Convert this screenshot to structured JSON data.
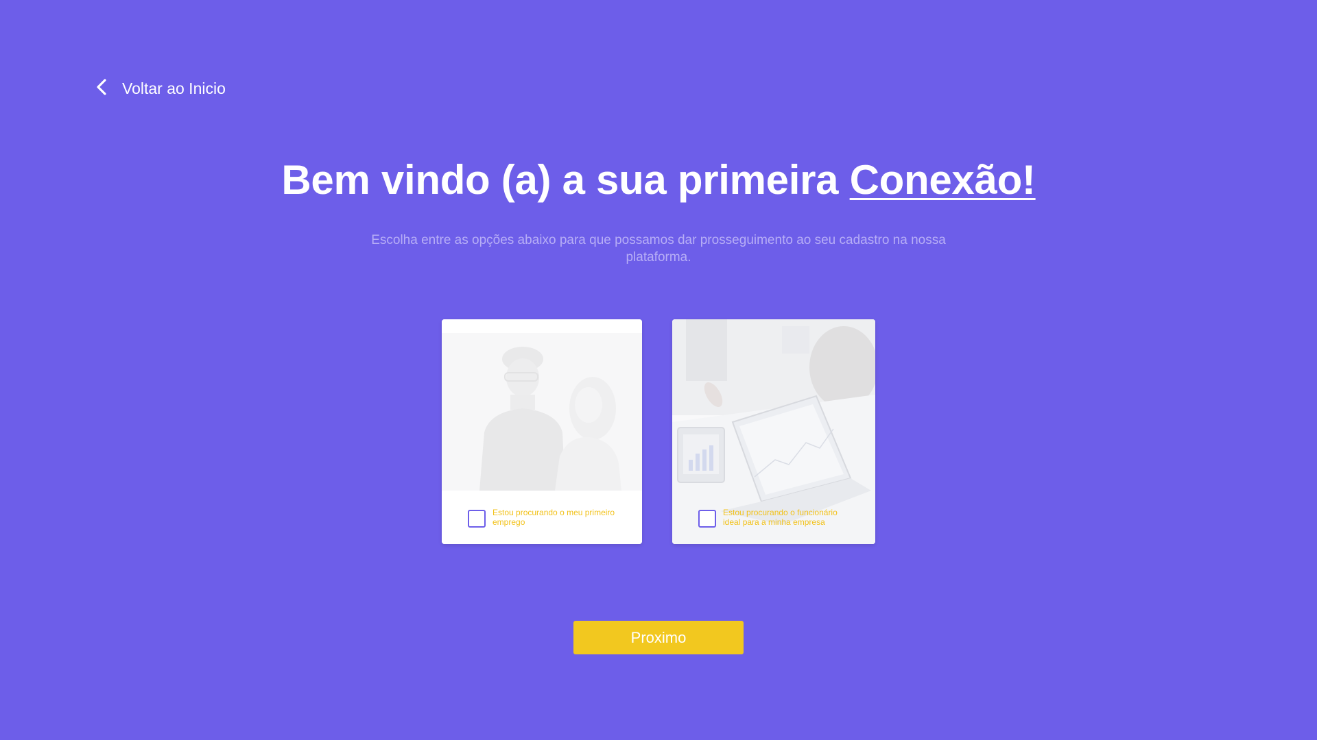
{
  "nav": {
    "back_label": "Voltar ao Inicio",
    "back_icon": "chevron-left-icon"
  },
  "header": {
    "title_main": "Bem vindo (a) a sua primeira ",
    "title_highlight": "Conexão!",
    "subtitle": "Escolha entre as opções abaixo para que possamos dar prosseguimento ao seu cadastro na nossa plataforma."
  },
  "options": [
    {
      "label": "Estou procurando o meu primeiro emprego",
      "checked": false
    },
    {
      "label": "Estou procurando o funcionário ideal para a minha empresa",
      "checked": false
    }
  ],
  "actions": {
    "next_label": "Proximo"
  },
  "colors": {
    "background": "#6D5EE9",
    "accent": "#F2C81F",
    "card": "#FFFFFF",
    "subtitle": "#B7AEF6"
  }
}
